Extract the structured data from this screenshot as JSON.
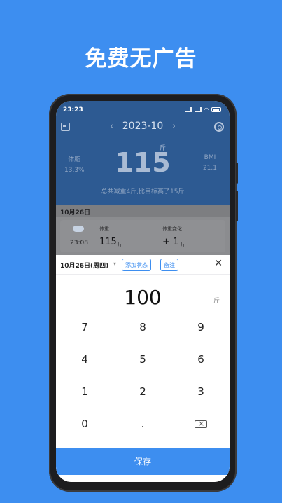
{
  "promo": {
    "headline": "免费无广告"
  },
  "status_bar": {
    "time": "23:23"
  },
  "header": {
    "month": "2023-10",
    "prev_arrow": "‹",
    "next_arrow": "›",
    "left_icon": "calendar-icon",
    "right_icon": "gear-icon"
  },
  "overview": {
    "body_fat_label": "体脂",
    "body_fat_value": "13.3%",
    "weight": "115",
    "weight_unit": "斤",
    "bmi_label": "BMI",
    "bmi_value": "21.1",
    "summary": "总共减重4斤,比目标高了15斤"
  },
  "record": {
    "date": "10月26日",
    "time": "23:08",
    "weight_label": "体重",
    "weight_value": "115",
    "weight_unit": "斤",
    "change_label": "体重变化",
    "change_value": "+ 1",
    "change_unit": "斤"
  },
  "entry_sheet": {
    "date": "10月26日(周四)",
    "add_status_label": "添加状态",
    "note_label": "备注",
    "value": "100",
    "unit": "斤",
    "keys": [
      "7",
      "8",
      "9",
      "4",
      "5",
      "6",
      "1",
      "2",
      "3",
      "0",
      "."
    ],
    "save_label": "保存"
  },
  "colors": {
    "accent": "#3d8ef0",
    "header_bg": "#2d5a92"
  }
}
